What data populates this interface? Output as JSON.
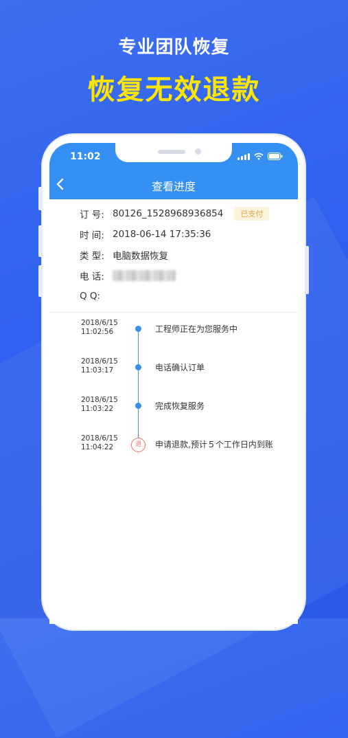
{
  "promo": {
    "subtitle": "专业团队恢复",
    "headline": "恢复无效退款"
  },
  "status_bar": {
    "time": "11:02",
    "icons": [
      "signal-icon",
      "wifi-icon",
      "battery-icon"
    ]
  },
  "nav": {
    "title": "查看进度",
    "back_icon": "chevron-left-icon"
  },
  "order": {
    "number_label": "订 号:",
    "number_value": "80126_1528968936854",
    "status_badge": "已支付",
    "time_label": "时 间:",
    "time_value": "2018-06-14 17:35:36",
    "type_label": "类 型:",
    "type_value": "电脑数据恢复",
    "phone_label": "电 话:",
    "qq_label": "Q Q:",
    "qq_value": ""
  },
  "timeline": [
    {
      "date": "2018/6/15",
      "time": "11:02:56",
      "text": "工程师正在为您服务中",
      "marker": "dot"
    },
    {
      "date": "2018/6/15",
      "time": "11:03:17",
      "text": "电话确认订单",
      "marker": "dot"
    },
    {
      "date": "2018/6/15",
      "time": "11:03:22",
      "text": "完成恢复服务",
      "marker": "dot"
    },
    {
      "date": "2018/6/15",
      "time": "11:04:22",
      "text": "申请退款,预计５个工作日内到账",
      "marker": "退"
    }
  ],
  "colors": {
    "background": "#2f62ee",
    "headline": "#ffe600",
    "appbar": "#3590f3",
    "badge_text": "#e0a243",
    "refund_marker": "#ee6d6d"
  }
}
